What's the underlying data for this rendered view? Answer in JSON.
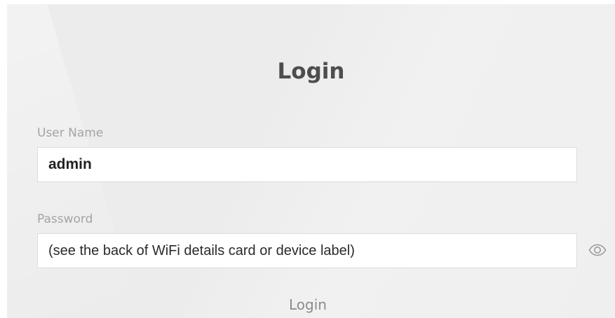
{
  "login": {
    "title": "Login",
    "username": {
      "label": "User Name",
      "value": "admin"
    },
    "password": {
      "label": "Password",
      "value": "(see the back of WiFi details card or device label)",
      "toggle_icon": "eye-icon"
    },
    "submit_label": "Login"
  }
}
